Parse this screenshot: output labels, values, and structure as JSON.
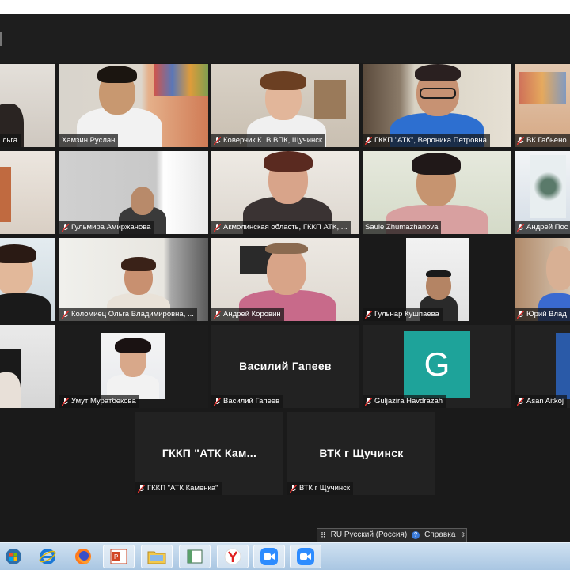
{
  "meeting": {
    "participants": [
      {
        "name": "льга",
        "muted": false
      },
      {
        "name": "Хамзин Руслан",
        "muted": false
      },
      {
        "name": "Коверчик К. В.ВПК, Щучинск",
        "muted": true
      },
      {
        "name": "ГККП \"АТК\", Вероника Петровна",
        "muted": true
      },
      {
        "name": "ВК Габьено",
        "muted": true
      },
      {
        "name": "",
        "muted": false
      },
      {
        "name": "Гульмира Амиржанова",
        "muted": true
      },
      {
        "name": "Акмолинская область, ГККП АТК, ...",
        "muted": true
      },
      {
        "name": "Saule Zhumazhanova",
        "muted": false
      },
      {
        "name": "Андрей Пос",
        "muted": true
      },
      {
        "name": "",
        "muted": false
      },
      {
        "name": "Коломиец Ольга Владимировна, ...",
        "muted": true
      },
      {
        "name": "Андрей Коровин",
        "muted": true
      },
      {
        "name": "Гульнар Кушпаева",
        "muted": true
      },
      {
        "name": "Юрий Влад",
        "muted": true
      },
      {
        "name": "",
        "muted": false
      },
      {
        "name": "Умут Муратбекова",
        "muted": true
      },
      {
        "name": "Василий Гапеев",
        "muted": true,
        "display": "Василий Гапеев"
      },
      {
        "name": "Guljazira Havdrazah",
        "muted": true,
        "avatar_letter": "G"
      },
      {
        "name": "Asan Aitkoj",
        "muted": true
      },
      {
        "name": "ГККП \"АТК Каменка\"",
        "muted": true,
        "display": "ГККП \"АТК Кам..."
      },
      {
        "name": "ВТК г Щучинск",
        "muted": true,
        "display": "ВТК г Щучинск"
      }
    ]
  },
  "language_bar": {
    "keyboard_icon": "keyboard-icon",
    "language": "RU Русский (Россия)",
    "help": "Справка",
    "help_icon": "help-icon"
  },
  "taskbar": {
    "apps": [
      "start-orb",
      "internet-explorer-icon",
      "firefox-icon",
      "powerpoint-icon",
      "file-explorer-icon",
      "window-icon",
      "yandex-browser-icon",
      "zoom-icon",
      "zoom-icon-2"
    ]
  },
  "colors": {
    "active_speaker": "#b9d94a",
    "avatar_bg": "#1ea39a",
    "muted_icon": "#e0312e"
  }
}
